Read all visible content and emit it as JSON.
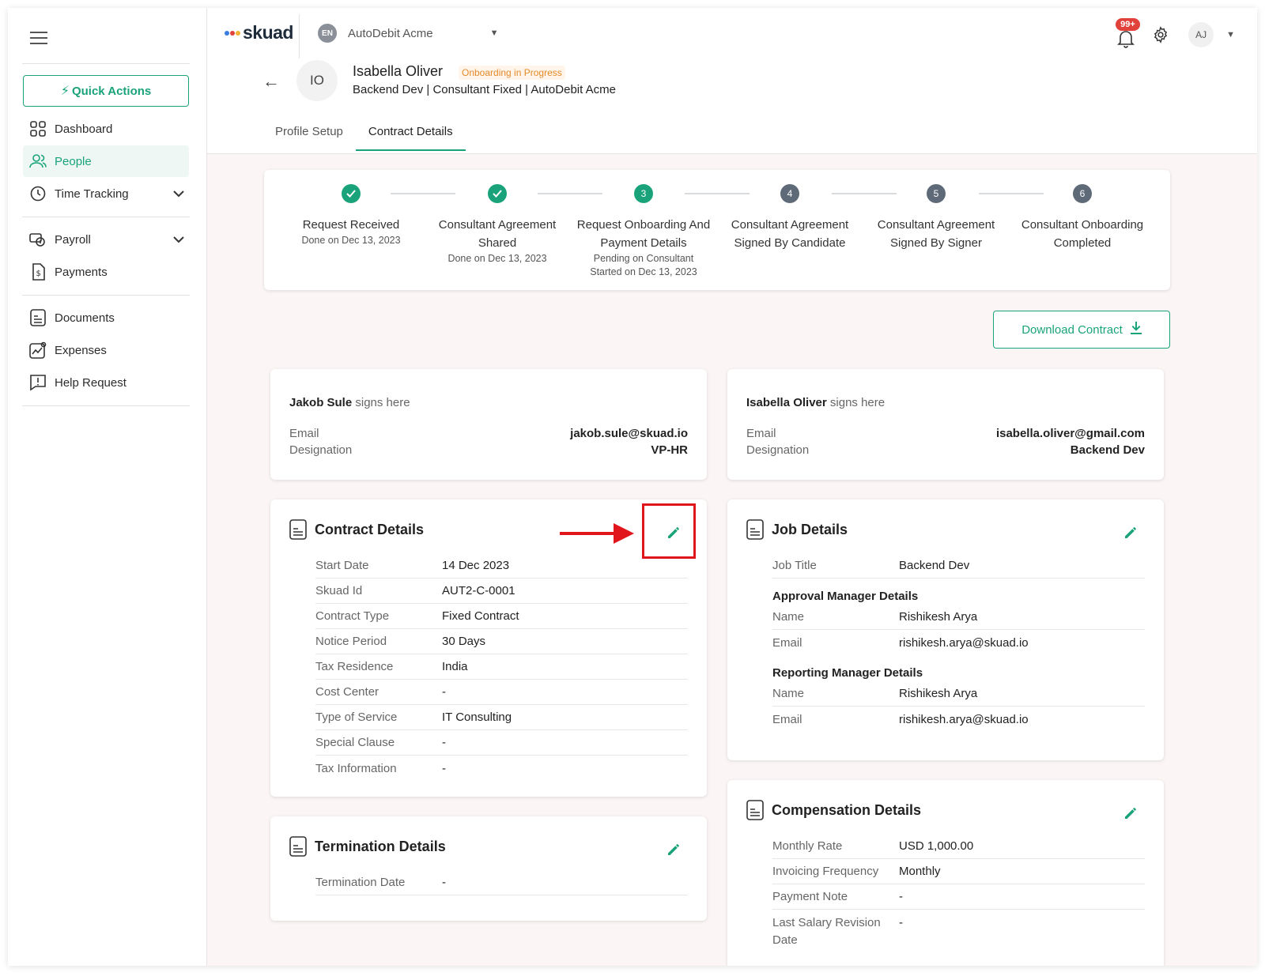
{
  "sidebar": {
    "quick_actions": "Quick Actions",
    "items": [
      {
        "label": "Dashboard"
      },
      {
        "label": "People"
      },
      {
        "label": "Time Tracking"
      },
      {
        "label": "Payroll"
      },
      {
        "label": "Payments"
      },
      {
        "label": "Documents"
      },
      {
        "label": "Expenses"
      },
      {
        "label": "Help Request"
      }
    ]
  },
  "header": {
    "brand": "skuad",
    "org_initials": "EN",
    "org_name": "AutoDebit Acme",
    "notifications": "99+",
    "user_initials": "AJ"
  },
  "profile": {
    "initials": "IO",
    "name": "Isabella Oliver",
    "status": "Onboarding in Progress",
    "subtitle": "Backend Dev | Consultant Fixed | AutoDebit Acme"
  },
  "tabs": [
    {
      "label": "Profile Setup"
    },
    {
      "label": "Contract Details"
    }
  ],
  "stepper": [
    {
      "num": "1",
      "label": "Request Received",
      "sub1": "Done on Dec 13, 2023",
      "sub2": "",
      "state": "done"
    },
    {
      "num": "2",
      "label": "Consultant Agreement Shared",
      "sub1": "Done on Dec 13, 2023",
      "sub2": "",
      "state": "done"
    },
    {
      "num": "3",
      "label": "Request Onboarding And Payment Details",
      "sub1": "Pending on Consultant",
      "sub2": "Started on Dec 13, 2023",
      "state": "current"
    },
    {
      "num": "4",
      "label": "Consultant Agreement Signed By Candidate",
      "sub1": "",
      "sub2": "",
      "state": "todo"
    },
    {
      "num": "5",
      "label": "Consultant Agreement Signed By Signer",
      "sub1": "",
      "sub2": "",
      "state": "todo"
    },
    {
      "num": "6",
      "label": "Consultant Onboarding Completed",
      "sub1": "",
      "sub2": "",
      "state": "todo"
    }
  ],
  "download_contract": "Download Contract",
  "signers": [
    {
      "name": "Jakob Sule",
      "suffix": "signs here",
      "email_label": "Email",
      "email": "jakob.sule@skuad.io",
      "designation_label": "Designation",
      "designation": "VP-HR"
    },
    {
      "name": "Isabella Oliver",
      "suffix": "signs here",
      "email_label": "Email",
      "email": "isabella.oliver@gmail.com",
      "designation_label": "Designation",
      "designation": "Backend Dev"
    }
  ],
  "contract_details": {
    "title": "Contract Details",
    "rows": [
      {
        "k": "Start Date",
        "v": "14 Dec 2023"
      },
      {
        "k": "Skuad Id",
        "v": "AUT2-C-0001"
      },
      {
        "k": "Contract Type",
        "v": "Fixed Contract"
      },
      {
        "k": "Notice Period",
        "v": "30 Days"
      },
      {
        "k": "Tax Residence",
        "v": "India"
      },
      {
        "k": "Cost Center",
        "v": "-"
      },
      {
        "k": "Type of Service",
        "v": "IT Consulting"
      },
      {
        "k": "Special Clause",
        "v": "-"
      },
      {
        "k": "Tax Information",
        "v": "-"
      }
    ]
  },
  "termination_details": {
    "title": "Termination Details",
    "rows": [
      {
        "k": "Termination Date",
        "v": "-"
      }
    ]
  },
  "job_details": {
    "title": "Job Details",
    "job_title_label": "Job Title",
    "job_title": "Backend Dev",
    "approval_heading": "Approval Manager Details",
    "approval": [
      {
        "k": "Name",
        "v": "Rishikesh Arya"
      },
      {
        "k": "Email",
        "v": "rishikesh.arya@skuad.io"
      }
    ],
    "reporting_heading": "Reporting Manager Details",
    "reporting": [
      {
        "k": "Name",
        "v": "Rishikesh Arya"
      },
      {
        "k": "Email",
        "v": "rishikesh.arya@skuad.io"
      }
    ]
  },
  "compensation_details": {
    "title": "Compensation Details",
    "rows": [
      {
        "k": "Monthly Rate",
        "v": "USD 1,000.00"
      },
      {
        "k": "Invoicing Frequency",
        "v": "Monthly"
      },
      {
        "k": "Payment Note",
        "v": "-"
      },
      {
        "k": "Last Salary Revision Date",
        "v": "-"
      }
    ]
  },
  "colors": {
    "accent": "#1aa37a",
    "status": "#e58a2b",
    "annotation": "#e0161c"
  }
}
